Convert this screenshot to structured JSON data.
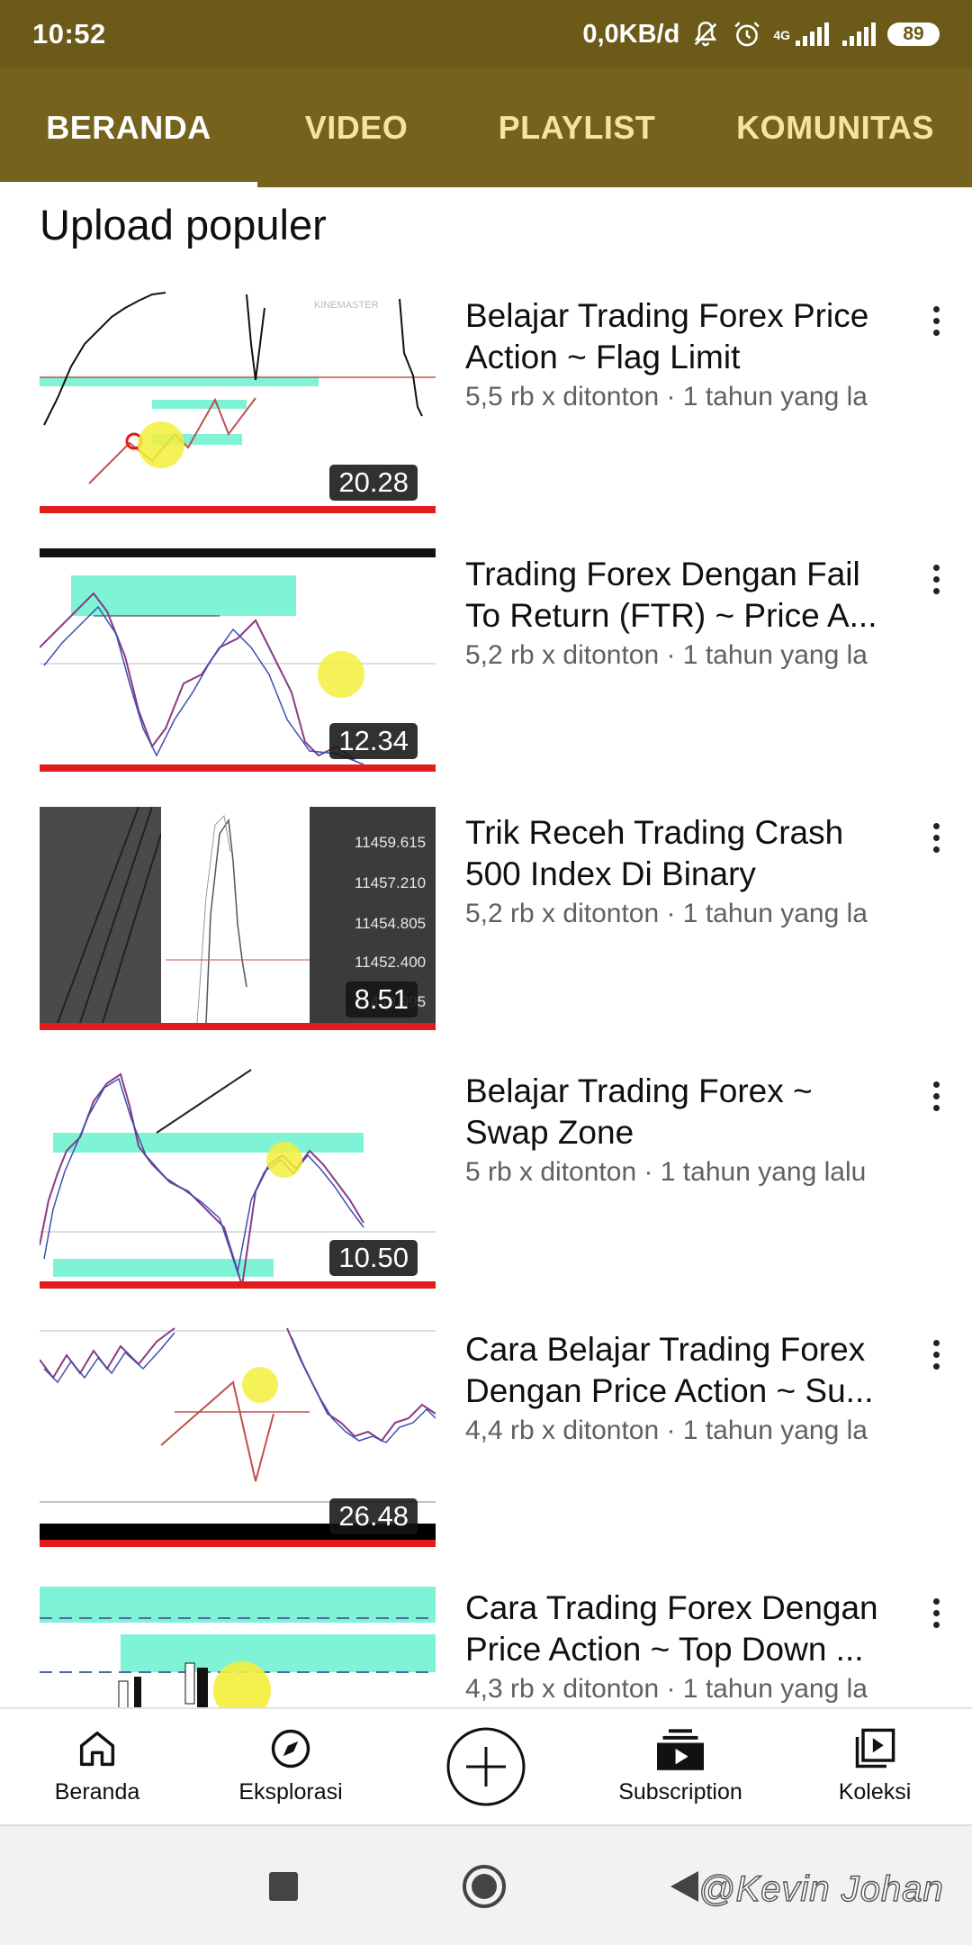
{
  "status_bar": {
    "time": "10:52",
    "data_speed": "0,0KB/d",
    "network": "4G",
    "battery": "89"
  },
  "tabs": [
    {
      "label": "BERANDA",
      "active": true
    },
    {
      "label": "VIDEO",
      "active": false
    },
    {
      "label": "PLAYLIST",
      "active": false
    },
    {
      "label": "KOMUNITAS",
      "active": false
    }
  ],
  "section_title": "Upload populer",
  "videos": [
    {
      "title": "Belajar Trading Forex Price Action ~ Flag Limit",
      "meta": "5,5 rb x ditonton · 1 tahun yang la",
      "duration": "20.28"
    },
    {
      "title": "Trading Forex Dengan Fail To Return (FTR) ~ Price A...",
      "meta": "5,2 rb x ditonton · 1 tahun yang la",
      "duration": "12.34"
    },
    {
      "title": "Trik Receh Trading Crash 500 Index Di Binary",
      "meta": "5,2 rb x ditonton · 1 tahun yang la",
      "duration": "8.51"
    },
    {
      "title": "Belajar Trading Forex ~ Swap Zone",
      "meta": "5 rb x ditonton · 1 tahun yang lalu",
      "duration": "10.50"
    },
    {
      "title": "Cara Belajar Trading Forex Dengan Price Action ~ Su...",
      "meta": "4,4 rb x ditonton · 1 tahun yang la",
      "duration": "26.48"
    },
    {
      "title": "Cara Trading Forex Dengan Price Action ~ Top Down ...",
      "meta": "4,3 rb x ditonton · 1 tahun yang la",
      "duration": ""
    }
  ],
  "bottom_nav": [
    {
      "label": "Beranda",
      "icon": "home-icon"
    },
    {
      "label": "Eksplorasi",
      "icon": "compass-icon"
    },
    {
      "label": "",
      "icon": "create-plus-icon"
    },
    {
      "label": "Subscription",
      "icon": "subscriptions-icon"
    },
    {
      "label": "Koleksi",
      "icon": "library-icon"
    }
  ],
  "watermark": "@Kevin Johan",
  "colors": {
    "header": "#75621d",
    "status_bar": "#6b5a18",
    "tab_inactive": "#f4e3a3",
    "zone_highlight": "#7ff3d5",
    "progress_red": "#e21b1b"
  }
}
